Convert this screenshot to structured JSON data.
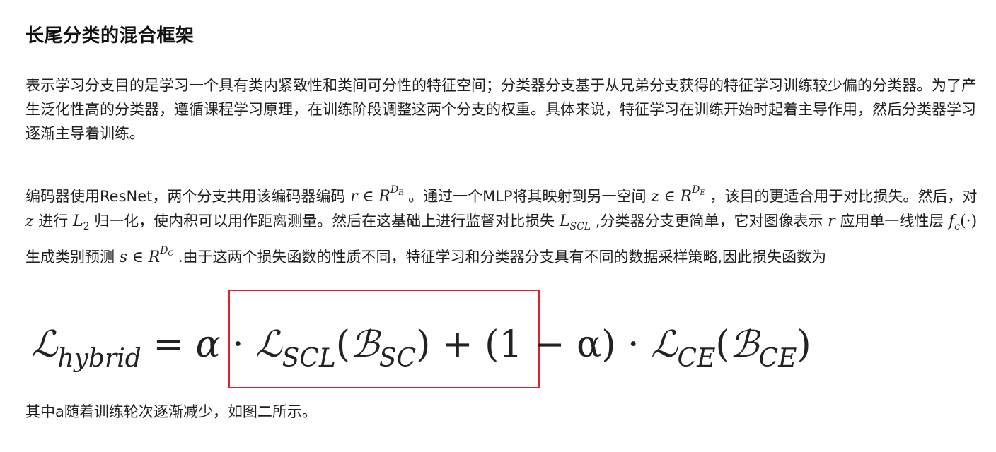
{
  "heading": "长尾分类的混合框架",
  "paragraph1": "表示学习分支目的是学习一个具有类内紧致性和类间可分性的特征空间；分类器分支基于从兄弟分支获得的特征学习训练较少偏的分类器。为了产生泛化性高的分类器，遵循课程学习原理，在训练阶段调整这两个分支的权重。具体来说，特征学习在训练开始时起着主导作用，然后分类器学习逐渐主导着训练。",
  "paragraph2": {
    "t1": "编码器使用ResNet，两个分支共用该编码器编码",
    "r": "r",
    "in": "∈",
    "R": "R",
    "D": "D",
    "E": "E",
    "t2": "。通过一个MLP将其映射到另一空间",
    "z": "z",
    "t3": "，该目的更适合用于对比损失。然后，对",
    "t4": "进行",
    "L": "L",
    "two": "2",
    "t5": "归一化，使内积可以用作距离测量。然后在这基础上进行监督对比损失",
    "SCL": "SCL",
    "t6": ",分类器分支更简单，它对图像表示",
    "t7": "应用单一线性层",
    "f": "f",
    "c": "c",
    "dot": "(·)",
    "t8": "生成类别预测",
    "s": "s",
    "C": "C",
    "t9": ".由于这两个损失函数的性质不同，特征学习和分类器分支具有不同的数据采样策略,因此损失函数为"
  },
  "equation": {
    "lhs": "ℒ",
    "lhs_sub": "hybrid",
    "equals": "=",
    "alpha": "α",
    "cdot": "·",
    "L_scl": "ℒ",
    "scl_sub": "SCL",
    "open": "(",
    "B": "ℬ",
    "b_sc_sub": "SC",
    "close": ")",
    "plus": "+",
    "one_minus_alpha": "(1 − α)",
    "L_ce": "ℒ",
    "ce_sub": "CE",
    "b_ce_sub": "CE"
  },
  "paragraph3": "其中a随着训练轮次逐渐减少，如图二所示。",
  "colors": {
    "highlight_border": "#e0202b",
    "text": "#1f1f1f"
  }
}
